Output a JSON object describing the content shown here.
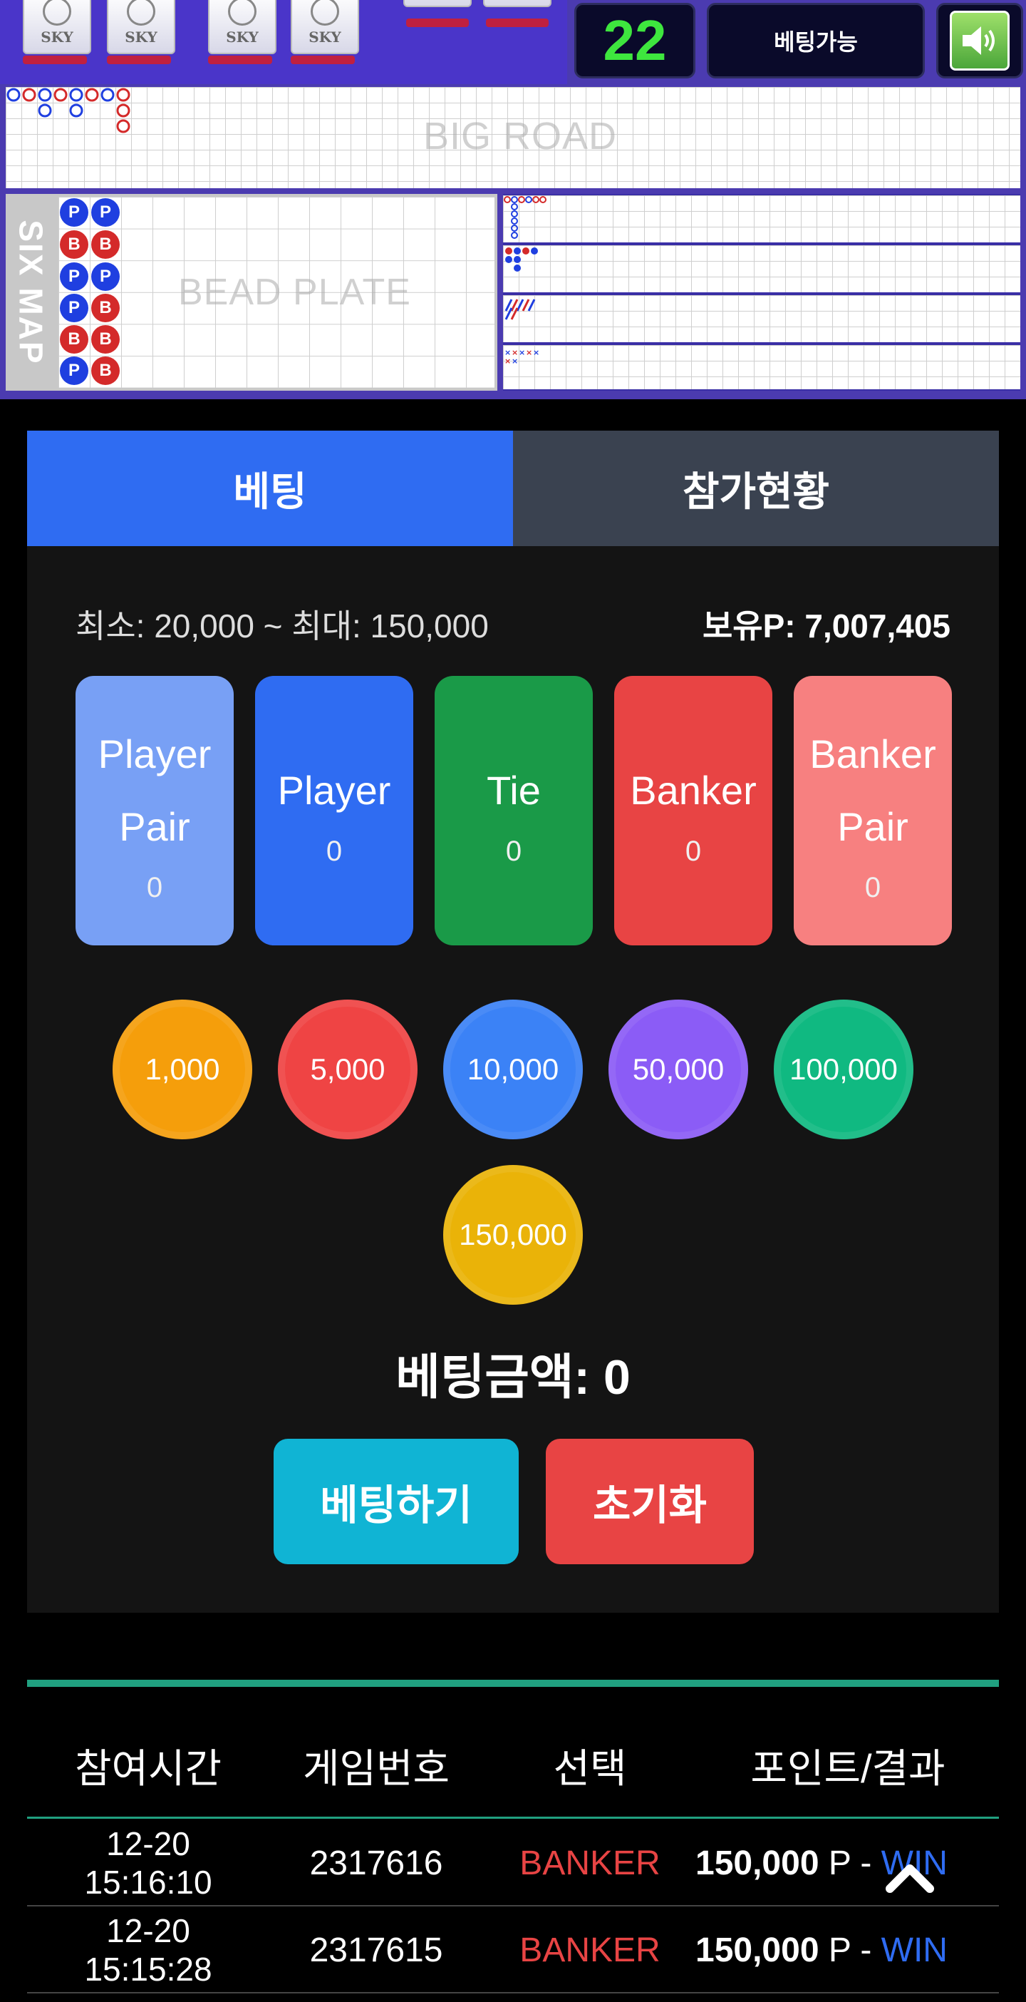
{
  "header": {
    "card_brand": "SKY",
    "round_number": "22",
    "status": "베팅가능",
    "sound_icon": "speaker-icon",
    "colors": {
      "round": "#3ee63e",
      "panel": "#0a0a2a"
    }
  },
  "roads": {
    "big_road_label": "BIG ROAD",
    "six_map_label": "SIX MAP",
    "bead_plate_label": "BEAD PLATE"
  },
  "tabs": {
    "betting": "베팅",
    "participation": "참가현황"
  },
  "limits": {
    "text": "최소: 20,000 ~ 최대: 150,000",
    "balance": "보유P: 7,007,405"
  },
  "bet_options": [
    {
      "line1": "Player",
      "line2": "Pair",
      "amount": "0",
      "color": "#78a0f5"
    },
    {
      "line1": "Player",
      "line2": "",
      "amount": "0",
      "color": "#2f6cf2"
    },
    {
      "line1": "Tie",
      "line2": "",
      "amount": "0",
      "color": "#1a9a48"
    },
    {
      "line1": "Banker",
      "line2": "",
      "amount": "0",
      "color": "#e84444"
    },
    {
      "line1": "Banker",
      "line2": "Pair",
      "amount": "0",
      "color": "#f78080"
    }
  ],
  "chips": [
    {
      "label": "1,000",
      "color": "#f59e0b"
    },
    {
      "label": "5,000",
      "color": "#ef4444"
    },
    {
      "label": "10,000",
      "color": "#3b82f6"
    },
    {
      "label": "50,000",
      "color": "#8b5cf6"
    },
    {
      "label": "100,000",
      "color": "#10b981"
    },
    {
      "label": "150,000",
      "color": "#eab308"
    }
  ],
  "bet_total": "베팅금액: 0",
  "actions": {
    "bet": "베팅하기",
    "reset": "초기화"
  },
  "history": {
    "headers": [
      "참여시간",
      "게임번호",
      "선택",
      "포인트/결과"
    ],
    "rows": [
      {
        "date": "12-20",
        "time": "15:16:10",
        "game": "2317616",
        "choice": "BANKER",
        "points": "150,000",
        "unit": " P - ",
        "result": "WIN"
      },
      {
        "date": "12-20",
        "time": "15:15:28",
        "game": "2317615",
        "choice": "BANKER",
        "points": "150,000",
        "unit": " P - ",
        "result": "WIN"
      }
    ]
  }
}
